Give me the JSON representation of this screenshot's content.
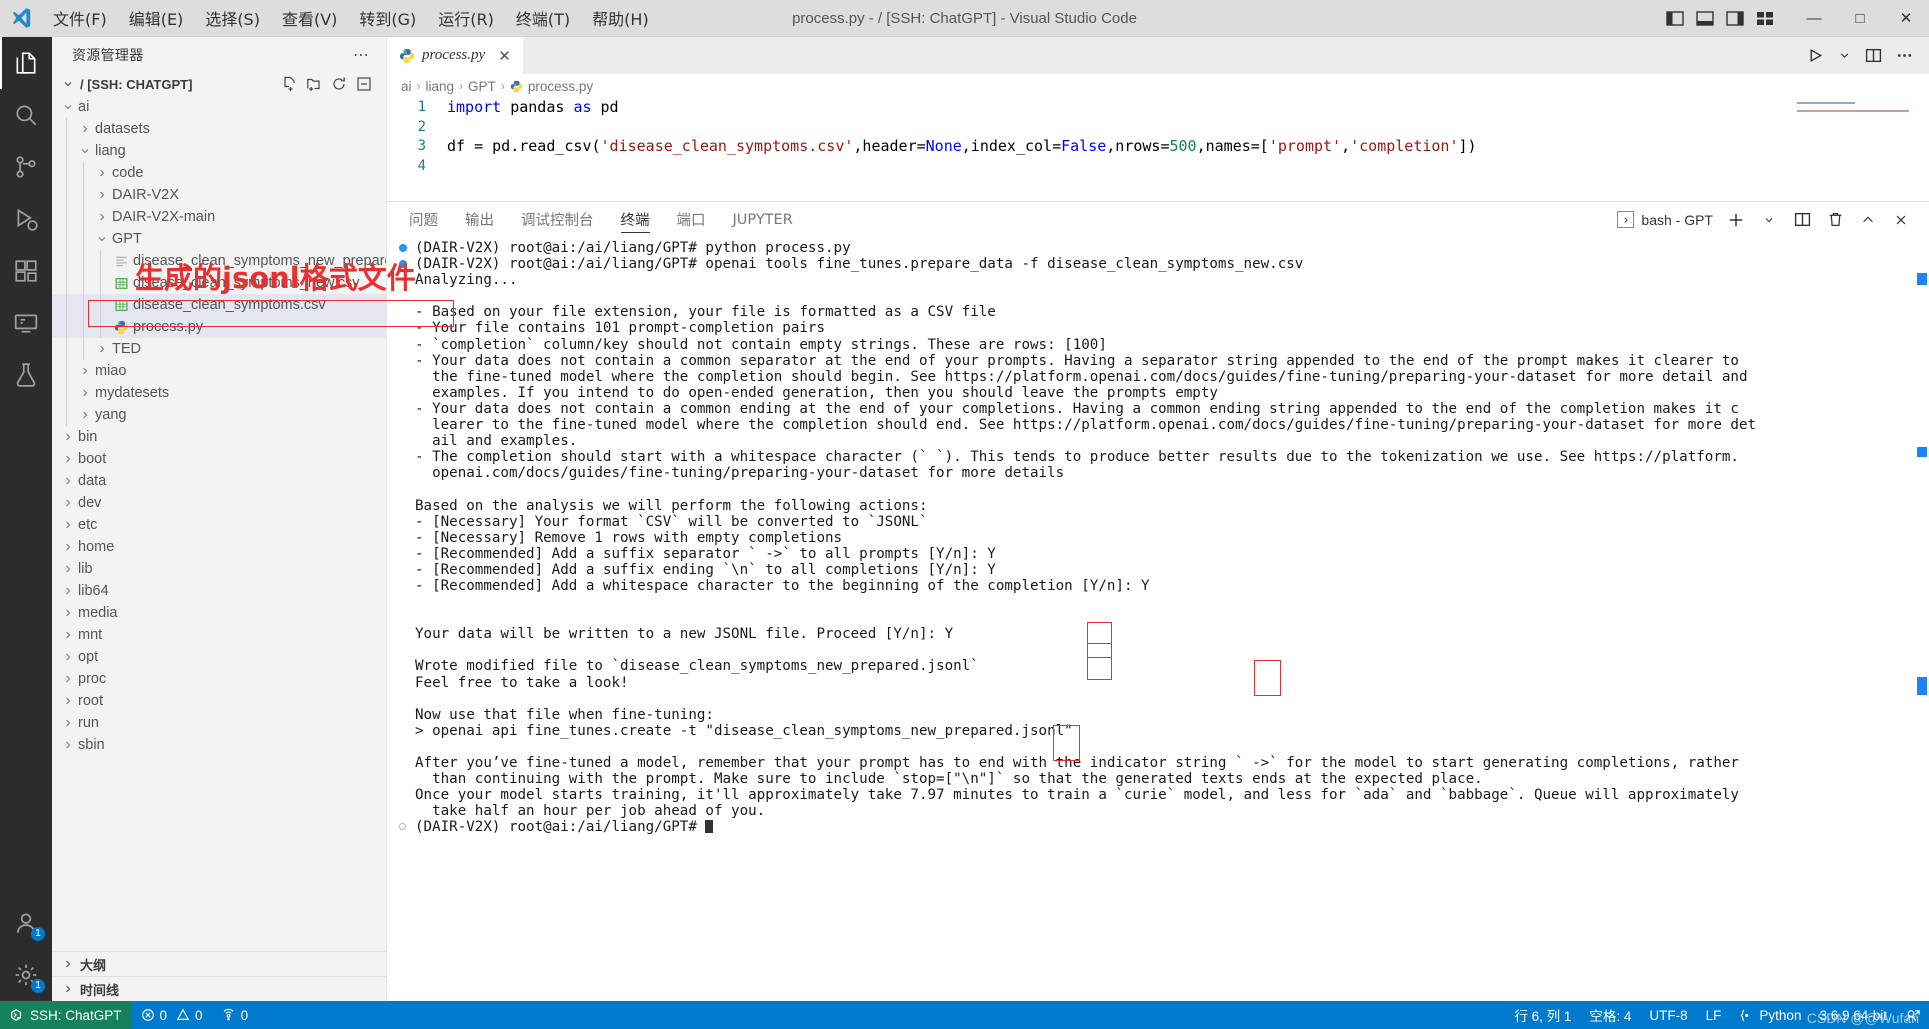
{
  "window": {
    "title": "process.py - / [SSH: ChatGPT] - Visual Studio Code",
    "minimize": "—",
    "maximize": "□",
    "close": "✕"
  },
  "menubar": {
    "items": [
      {
        "label": "文件(F)"
      },
      {
        "label": "编辑(E)"
      },
      {
        "label": "选择(S)"
      },
      {
        "label": "查看(V)"
      },
      {
        "label": "转到(G)"
      },
      {
        "label": "运行(R)"
      },
      {
        "label": "终端(T)"
      },
      {
        "label": "帮助(H)"
      }
    ]
  },
  "activitybar": {
    "items": [
      {
        "name": "explorer",
        "icon": "files-icon",
        "active": true,
        "badge": ""
      },
      {
        "name": "search",
        "icon": "search-icon",
        "active": false,
        "badge": ""
      },
      {
        "name": "source-control",
        "icon": "source-control-icon",
        "active": false,
        "badge": ""
      },
      {
        "name": "run-debug",
        "icon": "run-debug-icon",
        "active": false,
        "badge": ""
      },
      {
        "name": "extensions",
        "icon": "extensions-icon",
        "active": false,
        "badge": ""
      },
      {
        "name": "remote-explorer",
        "icon": "remote-explorer-icon",
        "active": false,
        "badge": ""
      },
      {
        "name": "testing",
        "icon": "beaker-icon",
        "active": false,
        "badge": ""
      }
    ],
    "bottom": [
      {
        "name": "accounts",
        "icon": "account-icon",
        "badge": "1"
      },
      {
        "name": "settings",
        "icon": "gear-icon",
        "badge": "1"
      }
    ]
  },
  "sidebar": {
    "title": "资源管理器",
    "more": "⋯",
    "root": {
      "label": "/ [SSH: CHATGPT]",
      "actions": [
        "new-file-icon",
        "new-folder-icon",
        "refresh-icon",
        "collapse-all-icon"
      ]
    },
    "tree": [
      {
        "label": "ai",
        "depth": 1,
        "type": "folder",
        "state": "open",
        "selected": false
      },
      {
        "label": "datasets",
        "depth": 2,
        "type": "folder",
        "state": "closed",
        "selected": false
      },
      {
        "label": "liang",
        "depth": 2,
        "type": "folder",
        "state": "open",
        "selected": false
      },
      {
        "label": "code",
        "depth": 3,
        "type": "folder",
        "state": "closed",
        "selected": false
      },
      {
        "label": "DAIR-V2X",
        "depth": 3,
        "type": "folder",
        "state": "closed",
        "selected": false
      },
      {
        "label": "DAIR-V2X-main",
        "depth": 3,
        "type": "folder",
        "state": "closed",
        "selected": false
      },
      {
        "label": "GPT",
        "depth": 3,
        "type": "folder",
        "state": "open",
        "selected": false
      },
      {
        "label": "disease_clean_symptoms_new_prepared.jsonl",
        "depth": 4,
        "type": "jsonl",
        "state": "",
        "selected": false
      },
      {
        "label": "disease_clean_symptoms_new.csv",
        "depth": 4,
        "type": "csv",
        "state": "",
        "selected": false
      },
      {
        "label": "disease_clean_symptoms.csv",
        "depth": 4,
        "type": "csv",
        "state": "",
        "selected": true
      },
      {
        "label": "process.py",
        "depth": 4,
        "type": "python",
        "state": "",
        "selected": true
      },
      {
        "label": "TED",
        "depth": 3,
        "type": "folder",
        "state": "closed",
        "selected": false
      },
      {
        "label": "miao",
        "depth": 2,
        "type": "folder",
        "state": "closed",
        "selected": false
      },
      {
        "label": "mydatesets",
        "depth": 2,
        "type": "folder",
        "state": "closed",
        "selected": false
      },
      {
        "label": "yang",
        "depth": 2,
        "type": "folder",
        "state": "closed",
        "selected": false
      },
      {
        "label": "bin",
        "depth": 1,
        "type": "folder",
        "state": "closed",
        "selected": false
      },
      {
        "label": "boot",
        "depth": 1,
        "type": "folder",
        "state": "closed",
        "selected": false
      },
      {
        "label": "data",
        "depth": 1,
        "type": "folder",
        "state": "closed",
        "selected": false
      },
      {
        "label": "dev",
        "depth": 1,
        "type": "folder",
        "state": "closed",
        "selected": false
      },
      {
        "label": "etc",
        "depth": 1,
        "type": "folder",
        "state": "closed",
        "selected": false
      },
      {
        "label": "home",
        "depth": 1,
        "type": "folder",
        "state": "closed",
        "selected": false
      },
      {
        "label": "lib",
        "depth": 1,
        "type": "folder",
        "state": "closed",
        "selected": false
      },
      {
        "label": "lib64",
        "depth": 1,
        "type": "folder",
        "state": "closed",
        "selected": false
      },
      {
        "label": "media",
        "depth": 1,
        "type": "folder",
        "state": "closed",
        "selected": false
      },
      {
        "label": "mnt",
        "depth": 1,
        "type": "folder",
        "state": "closed",
        "selected": false
      },
      {
        "label": "opt",
        "depth": 1,
        "type": "folder",
        "state": "closed",
        "selected": false
      },
      {
        "label": "proc",
        "depth": 1,
        "type": "folder",
        "state": "closed",
        "selected": false
      },
      {
        "label": "root",
        "depth": 1,
        "type": "folder",
        "state": "closed",
        "selected": false
      },
      {
        "label": "run",
        "depth": 1,
        "type": "folder",
        "state": "closed",
        "selected": false
      },
      {
        "label": "sbin",
        "depth": 1,
        "type": "folder",
        "state": "closed",
        "selected": false
      }
    ],
    "sections": [
      {
        "label": "大纲"
      },
      {
        "label": "时间线"
      }
    ]
  },
  "editor": {
    "tab": {
      "label": "process.py",
      "icon": "python-icon",
      "close": "✕"
    },
    "actions": [
      "run-icon",
      "chevron-down-icon",
      "split-editor-icon",
      "more-actions-icon"
    ],
    "breadcrumb": [
      "ai",
      "liang",
      "GPT",
      "process.py"
    ],
    "lines": [
      {
        "no": "1"
      },
      {
        "no": "2"
      },
      {
        "no": "3"
      },
      {
        "no": "4"
      }
    ],
    "code": {
      "line1": {
        "kw": "import",
        "rest": " pandas ",
        "kw2": "as",
        "rest2": " pd"
      },
      "line3_pre": "df = pd.read_csv(",
      "line3_str": "'disease_clean_symptoms.csv'",
      "line3_mid1": ",header=",
      "line3_c1": "None",
      "line3_mid2": ",index_col=",
      "line3_c2": "False",
      "line3_mid3": ",nrows=",
      "line3_n": "500",
      "line3_mid4": ",names=[",
      "line3_s2": "'prompt'",
      "line3_comma": ",",
      "line3_s3": "'completion'",
      "line3_end": "])"
    }
  },
  "panel": {
    "tabs": [
      {
        "label": "问题",
        "active": false
      },
      {
        "label": "输出",
        "active": false
      },
      {
        "label": "调试控制台",
        "active": false
      },
      {
        "label": "终端",
        "active": true
      },
      {
        "label": "端口",
        "active": false
      },
      {
        "label": "JUPYTER",
        "active": false
      }
    ],
    "terminal_selector": {
      "glyph": "›",
      "label": "bash - GPT"
    },
    "actions": [
      "add-terminal-icon",
      "chevron-down-icon",
      "split-terminal-icon",
      "kill-terminal-icon",
      "maximize-panel-icon",
      "close-panel-icon"
    ]
  },
  "terminal": {
    "lines": [
      {
        "bullet": "filled",
        "text": "(DAIR-V2X) root@ai:/ai/liang/GPT# python process.py"
      },
      {
        "bullet": "filled",
        "text": "(DAIR-V2X) root@ai:/ai/liang/GPT# openai tools fine_tunes.prepare_data -f disease_clean_symptoms_new.csv"
      },
      {
        "bullet": "none",
        "text": "Analyzing..."
      },
      {
        "bullet": "none",
        "text": ""
      },
      {
        "bullet": "none",
        "text": "- Based on your file extension, your file is formatted as a CSV file"
      },
      {
        "bullet": "none",
        "text": "- Your file contains 101 prompt-completion pairs"
      },
      {
        "bullet": "none",
        "text": "- `completion` column/key should not contain empty strings. These are rows: [100]"
      },
      {
        "bullet": "none",
        "text": "- Your data does not contain a common separator at the end of your prompts. Having a separator string appended to the end of the prompt makes it clearer to"
      },
      {
        "bullet": "none",
        "text": "  the fine-tuned model where the completion should begin. See https://platform.openai.com/docs/guides/fine-tuning/preparing-your-dataset for more detail and"
      },
      {
        "bullet": "none",
        "text": "  examples. If you intend to do open-ended generation, then you should leave the prompts empty"
      },
      {
        "bullet": "none",
        "text": "- Your data does not contain a common ending at the end of your completions. Having a common ending string appended to the end of the completion makes it c"
      },
      {
        "bullet": "none",
        "text": "  learer to the fine-tuned model where the completion should end. See https://platform.openai.com/docs/guides/fine-tuning/preparing-your-dataset for more det"
      },
      {
        "bullet": "none",
        "text": "  ail and examples."
      },
      {
        "bullet": "none",
        "text": "- The completion should start with a whitespace character (` `). This tends to produce better results due to the tokenization we use. See https://platform."
      },
      {
        "bullet": "none",
        "text": "  openai.com/docs/guides/fine-tuning/preparing-your-dataset for more details"
      },
      {
        "bullet": "none",
        "text": ""
      },
      {
        "bullet": "none",
        "text": "Based on the analysis we will perform the following actions:"
      },
      {
        "bullet": "none",
        "text": "- [Necessary] Your format `CSV` will be converted to `JSONL`"
      },
      {
        "bullet": "none",
        "text": "- [Necessary] Remove 1 rows with empty completions"
      },
      {
        "bullet": "none",
        "text": "- [Recommended] Add a suffix separator ` ->` to all prompts [Y/n]: Y"
      },
      {
        "bullet": "none",
        "text": "- [Recommended] Add a suffix ending `\\n` to all completions [Y/n]: Y"
      },
      {
        "bullet": "none",
        "text": "- [Recommended] Add a whitespace character to the beginning of the completion [Y/n]: Y"
      },
      {
        "bullet": "none",
        "text": ""
      },
      {
        "bullet": "none",
        "text": ""
      },
      {
        "bullet": "none",
        "text": "Your data will be written to a new JSONL file. Proceed [Y/n]: Y"
      },
      {
        "bullet": "none",
        "text": ""
      },
      {
        "bullet": "none",
        "text": "Wrote modified file to `disease_clean_symptoms_new_prepared.jsonl`"
      },
      {
        "bullet": "none",
        "text": "Feel free to take a look!"
      },
      {
        "bullet": "none",
        "text": ""
      },
      {
        "bullet": "none",
        "text": "Now use that file when fine-tuning:"
      },
      {
        "bullet": "none",
        "text": "> openai api fine_tunes.create -t \"disease_clean_symptoms_new_prepared.jsonl\""
      },
      {
        "bullet": "none",
        "text": ""
      },
      {
        "bullet": "none",
        "text": "After you’ve fine-tuned a model, remember that your prompt has to end with the indicator string ` ->` for the model to start generating completions, rather"
      },
      {
        "bullet": "none",
        "text": "  than continuing with the prompt. Make sure to include `stop=[\"\\n\"]` so that the generated texts ends at the expected place."
      },
      {
        "bullet": "none",
        "text": "Once your model starts training, it'll approximately take 7.97 minutes to train a `curie` model, and less for `ada` and `babbage`. Queue will approximately"
      },
      {
        "bullet": "none",
        "text": "  take half an hour per job ahead of you."
      },
      {
        "bullet": "prompt",
        "text": "(DAIR-V2X) root@ai:/ai/liang/GPT# "
      }
    ]
  },
  "annotations": {
    "note": "生成的jsonl格式文件",
    "color": "#e83030"
  },
  "statusbar": {
    "remote": {
      "icon": "remote-icon",
      "label": "SSH: ChatGPT"
    },
    "errors": "0",
    "warnings": "0",
    "ports": "0",
    "right": [
      {
        "label": "行 6, 列 1",
        "name": "cursor-position"
      },
      {
        "label": "空格: 4",
        "name": "indentation"
      },
      {
        "label": "UTF-8",
        "name": "encoding"
      },
      {
        "label": "LF",
        "name": "eol"
      },
      {
        "label": "Python",
        "name": "language-mode"
      },
      {
        "label": "3.6.9 64-bit",
        "name": "python-interpreter"
      }
    ],
    "watermark": "CSDN @@Wufan"
  }
}
